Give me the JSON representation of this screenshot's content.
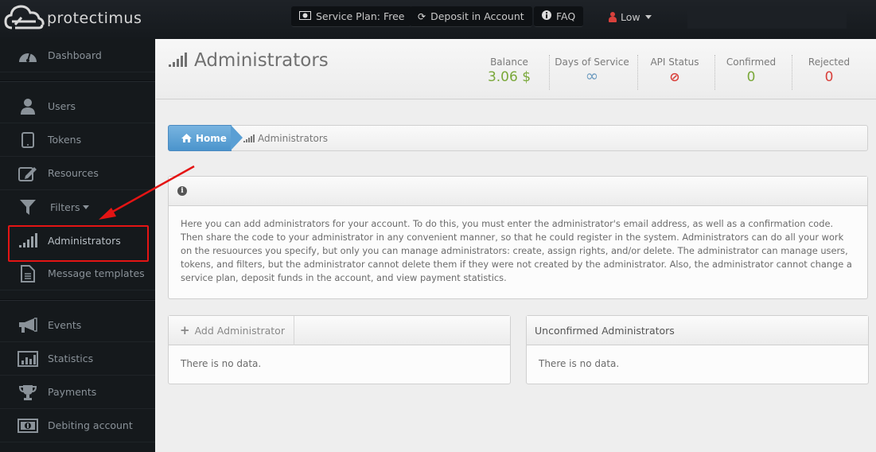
{
  "brand": {
    "name": "protectimus"
  },
  "topbar": {
    "service_plan": "Service Plan: Free",
    "deposit": "Deposit in Account",
    "faq": "FAQ",
    "user": "Low"
  },
  "sidebar": {
    "items": [
      {
        "label": "Dashboard",
        "icon": "dashboard-icon"
      },
      {
        "label": "Users",
        "icon": "user-icon"
      },
      {
        "label": "Tokens",
        "icon": "tablet-icon"
      },
      {
        "label": "Resources",
        "icon": "edit-icon"
      },
      {
        "label": "Filters",
        "icon": "filter-icon"
      },
      {
        "label": "Administrators",
        "icon": "signal-bars-icon"
      },
      {
        "label": "Message templates",
        "icon": "document-icon"
      },
      {
        "label": "Events",
        "icon": "megaphone-icon"
      },
      {
        "label": "Statistics",
        "icon": "bar-chart-icon"
      },
      {
        "label": "Payments",
        "icon": "trophy-icon"
      },
      {
        "label": "Debiting account",
        "icon": "money-icon"
      }
    ],
    "active": "Administrators"
  },
  "header": {
    "title": "Administrators",
    "stats": [
      {
        "label": "Balance",
        "value": "3.06 $",
        "color": "#7aa83a"
      },
      {
        "label": "Days of Service",
        "value": "∞",
        "color": "#6e9cc0"
      },
      {
        "label": "API Status",
        "value": "⊘",
        "color": "#d9413c"
      },
      {
        "label": "Confirmed",
        "value": "0",
        "color": "#7aa83a"
      },
      {
        "label": "Rejected",
        "value": "0",
        "color": "#d9413c"
      }
    ]
  },
  "breadcrumb": {
    "home": "Home",
    "current": "Administrators"
  },
  "info": {
    "text": "Here you can add administrators for your account. To do this, you must enter the administrator's email address, as well as a confirmation code. Then share the code to your administrator in any convenient manner, so that he could register in the system. Administrators can do all your work on the resuources you specify, but only you can manage administrators: create, assign rights, and/or delete. The administrator can manage users, tokens, and filters, but the administrator cannot delete them if they were not created by the administrator. Also, the administrator cannot change a service plan, deposit funds in the account, and view payment statistics."
  },
  "add_panel": {
    "button": "Add Administrator",
    "empty": "There is no data."
  },
  "unconfirmed_panel": {
    "title": "Unconfirmed Administrators",
    "empty": "There is no data."
  }
}
